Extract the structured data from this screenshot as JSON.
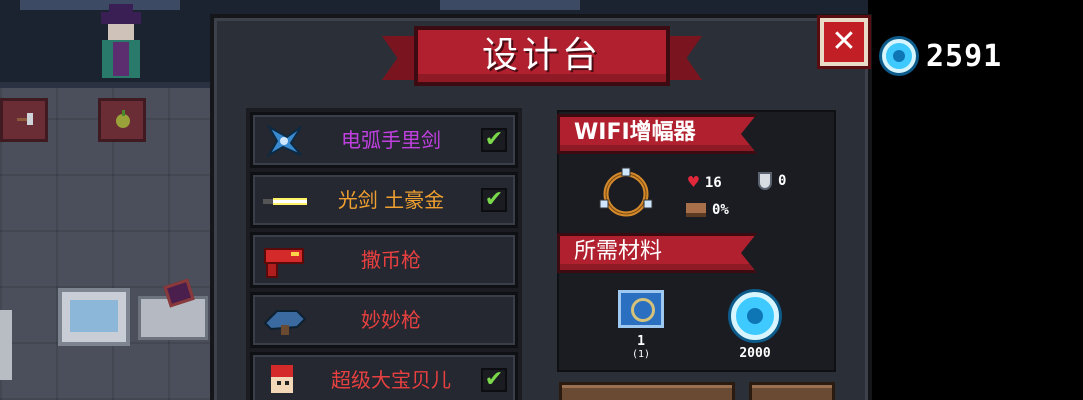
{
  "header": {
    "title": "设计台",
    "close_label": "✕",
    "gem_count": "2591"
  },
  "items": [
    {
      "name": "电弧手里剑",
      "color": "#c040e0",
      "checked": true,
      "icon": "shuriken-icon"
    },
    {
      "name": "光剑 土豪金",
      "color": "#f0a030",
      "checked": true,
      "icon": "lightsaber-icon"
    },
    {
      "name": "撒币枪",
      "color": "#e84040",
      "checked": false,
      "icon": "coin-gun-icon"
    },
    {
      "name": "妙妙枪",
      "color": "#e84040",
      "checked": false,
      "icon": "miao-gun-icon"
    },
    {
      "name": "超级大宝贝儿",
      "color": "#e84040",
      "checked": true,
      "icon": "super-baby-icon"
    }
  ],
  "detail": {
    "item_title": "WIFI增幅器",
    "stats": {
      "hp": "16",
      "armor": "0",
      "speed": "0%"
    },
    "materials_title": "所需材料",
    "materials": [
      {
        "icon": "blueprint-icon",
        "count": "1",
        "owned": "(1)"
      },
      {
        "icon": "gem-icon",
        "count": "2000"
      }
    ]
  },
  "check_mark": "✔"
}
